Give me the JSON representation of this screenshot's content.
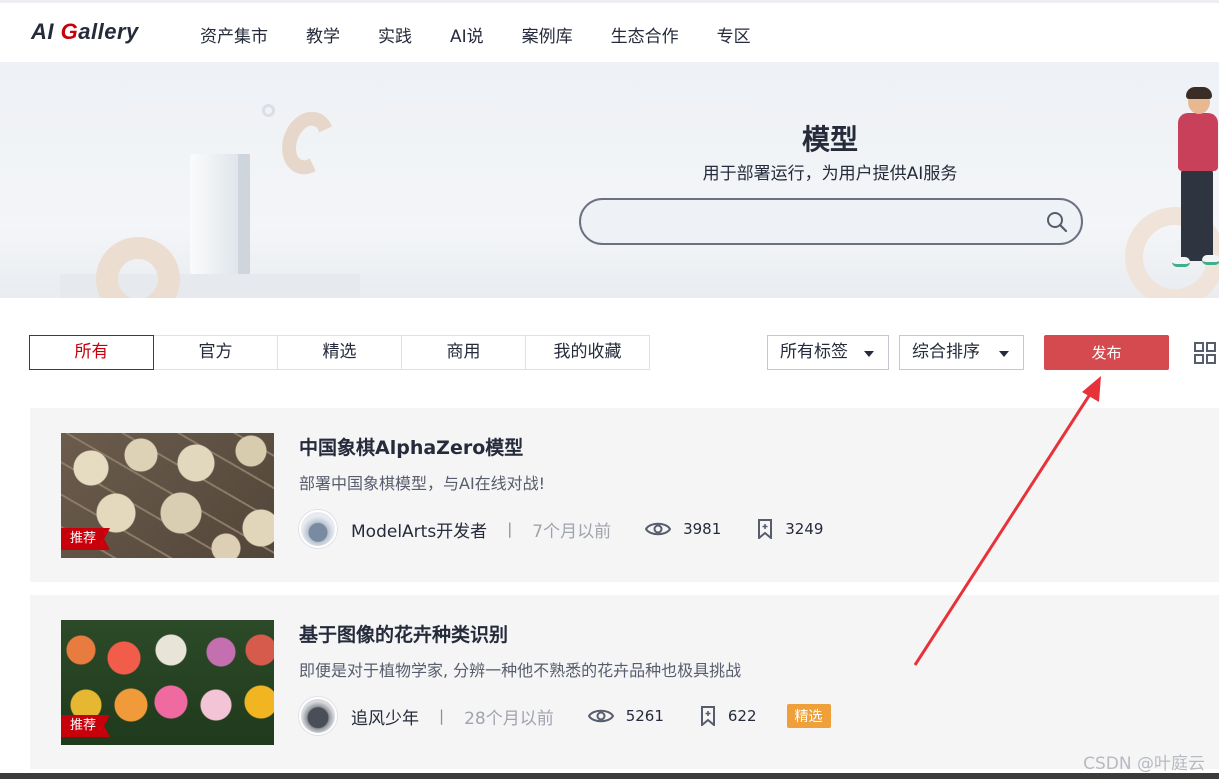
{
  "logo": {
    "prefix": "AI ",
    "g": "G",
    "rest": "allery"
  },
  "nav": [
    "资产集市",
    "教学",
    "实践",
    "AI说",
    "案例库",
    "生态合作",
    "专区"
  ],
  "hero": {
    "title": "模型",
    "subtitle": "用于部署运行，为用户提供AI服务",
    "search_placeholder": "",
    "search_icon": "search-icon"
  },
  "tabs": [
    "所有",
    "官方",
    "精选",
    "商用",
    "我的收藏"
  ],
  "active_tab": "所有",
  "filters": {
    "tags": "所有标签",
    "sort": "综合排序"
  },
  "publish_label": "发布",
  "cards": [
    {
      "title": "中国象棋AlphaZero模型",
      "desc": "部署中国象棋模型，与AI在线对战!",
      "badge": "推荐",
      "author": "ModelArts开发者",
      "sep": "|",
      "time": "7个月以前",
      "views": "3981",
      "stars": "3249"
    },
    {
      "title": "基于图像的花卉种类识别",
      "desc": "即便是对于植物学家, 分辨一种他不熟悉的花卉品种也极具挑战",
      "badge": "推荐",
      "author": "追风少年",
      "sep": "|",
      "time": "28个月以前",
      "views": "5261",
      "stars": "622",
      "tag": "精选"
    }
  ],
  "watermark": "CSDN @叶庭云",
  "colors": {
    "brand": "#c7000b",
    "publish": "#d44a4f",
    "pick_tag": "#f0a03a",
    "annotation_arrow": "#e8323a"
  }
}
